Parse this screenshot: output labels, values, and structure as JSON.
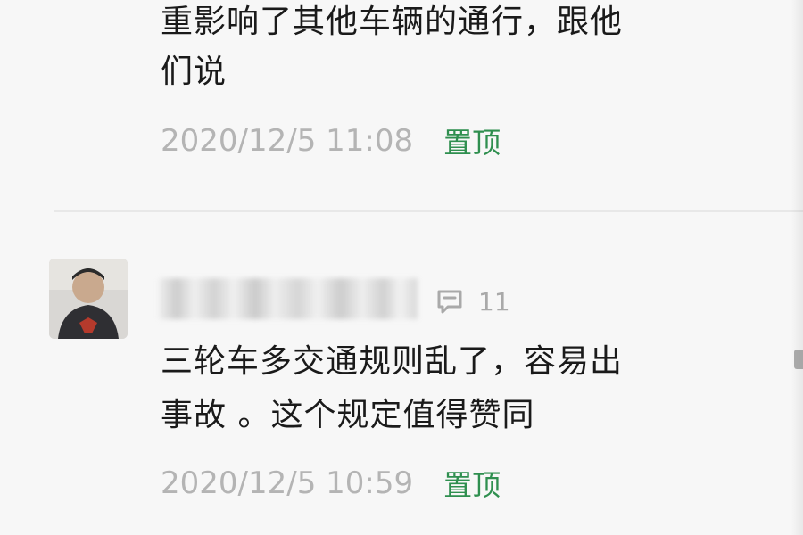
{
  "comment_prev": {
    "lines": [
      "重影响了其他车辆的通行，跟他",
      "们说"
    ],
    "time": "2020/12/5 11:08",
    "pin_label": "置顶"
  },
  "comment_main": {
    "reply_count": "11",
    "lines": [
      "三轮车多交通规则乱了，容易出",
      "事故 。这个规定值得赞同"
    ],
    "time": "2020/12/5 10:59",
    "pin_label": "置顶"
  },
  "icons": {
    "reply": "speech-bubble-icon"
  },
  "colors": {
    "background": "#f7f7f7",
    "text": "#1a1a1a",
    "meta_text": "#b4b4b4",
    "pin_green": "#2f8f4f"
  }
}
